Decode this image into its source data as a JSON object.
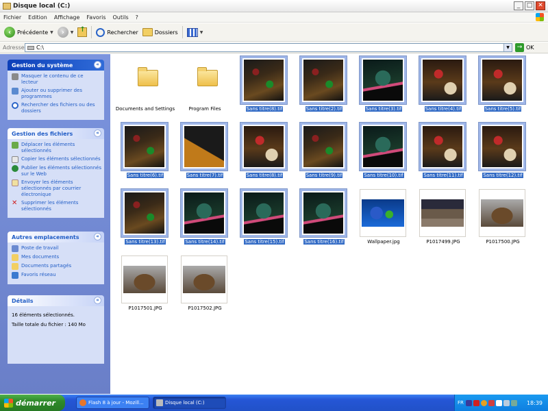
{
  "window": {
    "title": "Disque local (C:)"
  },
  "menu": [
    "Fichier",
    "Edition",
    "Affichage",
    "Favoris",
    "Outils",
    "?"
  ],
  "toolbar": {
    "back_label": "Précédente",
    "search_label": "Rechercher",
    "folders_label": "Dossiers"
  },
  "address": {
    "label": "Adresse",
    "value": "C:\\",
    "go_label": "OK"
  },
  "panels": {
    "system": {
      "title": "Gestion du système",
      "links": [
        "Masquer le contenu de ce lecteur",
        "Ajouter ou supprimer des programmes",
        "Rechercher des fichiers ou des dossiers"
      ]
    },
    "files": {
      "title": "Gestion des fichiers",
      "links": [
        "Déplacer les éléments sélectionnés",
        "Copier les éléments sélectionnés",
        "Publier les éléments sélectionnés sur le Web",
        "Envoyer les éléments sélectionnés par courrier électronique",
        "Supprimer les éléments sélectionnés"
      ]
    },
    "places": {
      "title": "Autres emplacements",
      "links": [
        "Poste de travail",
        "Mes documents",
        "Documents partagés",
        "Favoris réseau"
      ]
    },
    "details": {
      "title": "Détails",
      "lines": [
        "16 éléments sélectionnés.",
        "Taille totale du fichier : 140 Mo"
      ]
    }
  },
  "files": [
    {
      "name": "Documents and Settings",
      "kind": "folder",
      "selected": false
    },
    {
      "name": "Program Files",
      "kind": "folder",
      "selected": false
    },
    {
      "name": "Sans titre(8).tif",
      "kind": "pin-a",
      "selected": true
    },
    {
      "name": "Sans titre(2).tif",
      "kind": "pin-a",
      "selected": true
    },
    {
      "name": "Sans titre(3).tif",
      "kind": "pin-c",
      "selected": true
    },
    {
      "name": "Sans titre(4).tif",
      "kind": "pin-d",
      "selected": true
    },
    {
      "name": "Sans titre(5).tif",
      "kind": "pin-d",
      "selected": true
    },
    {
      "name": "Sans titre(6).tif",
      "kind": "pin-a",
      "selected": true
    },
    {
      "name": "Sans titre(7).tif",
      "kind": "pin-b",
      "selected": true
    },
    {
      "name": "Sans titre(8).tif",
      "kind": "pin-d",
      "selected": true
    },
    {
      "name": "Sans titre(9).tif",
      "kind": "pin-a",
      "selected": true
    },
    {
      "name": "Sans titre(10).tif",
      "kind": "pin-c",
      "selected": true
    },
    {
      "name": "Sans titre(11).tif",
      "kind": "pin-d",
      "selected": true
    },
    {
      "name": "Sans titre(12).tif",
      "kind": "pin-d",
      "selected": true
    },
    {
      "name": "Sans titre(13).tif",
      "kind": "pin-a",
      "selected": true
    },
    {
      "name": "Sans titre(14).tif",
      "kind": "pin-c",
      "selected": true
    },
    {
      "name": "Sans titre(15).tif",
      "kind": "pin-c",
      "selected": true
    },
    {
      "name": "Sans titre(16).tif",
      "kind": "pin-c",
      "selected": true
    },
    {
      "name": "Wallpaper.jpg",
      "kind": "wall",
      "selected": false
    },
    {
      "name": "P1017499.JPG",
      "kind": "photo-a",
      "selected": false
    },
    {
      "name": "P1017500.JPG",
      "kind": "photo-b",
      "selected": false
    },
    {
      "name": "P1017501.JPG",
      "kind": "photo-b",
      "selected": false
    },
    {
      "name": "P1017502.JPG",
      "kind": "photo-b",
      "selected": false
    }
  ],
  "taskbar": {
    "start_label": "démarrer",
    "tasks": [
      {
        "label": "Flash 8 à jour - Mozill...",
        "active": false
      },
      {
        "label": "Disque local (C:)",
        "active": true
      }
    ],
    "lang": "FR",
    "clock": "18:39"
  }
}
